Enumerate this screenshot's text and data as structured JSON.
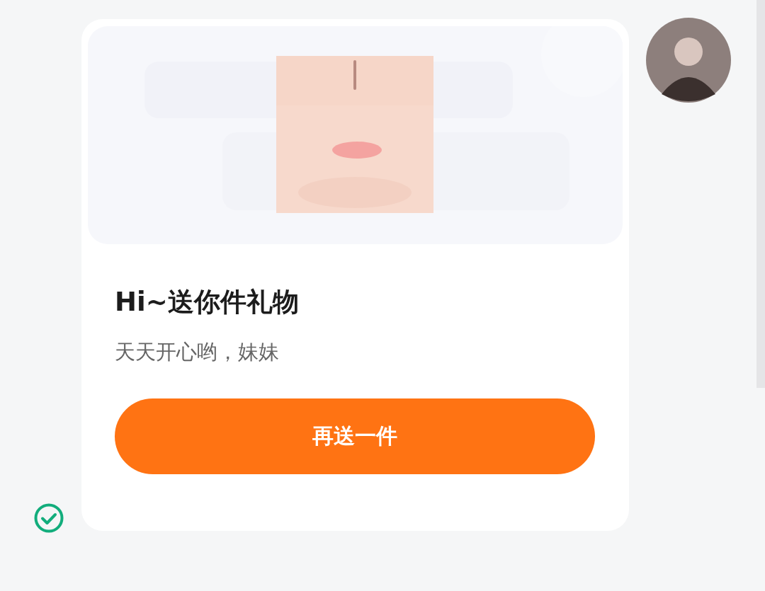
{
  "message": {
    "title": "Hi~送你件礼物",
    "text": "天天开心哟，妹妹",
    "button": "再送一件",
    "sent": true
  },
  "sender": {
    "kind": "avatar"
  }
}
